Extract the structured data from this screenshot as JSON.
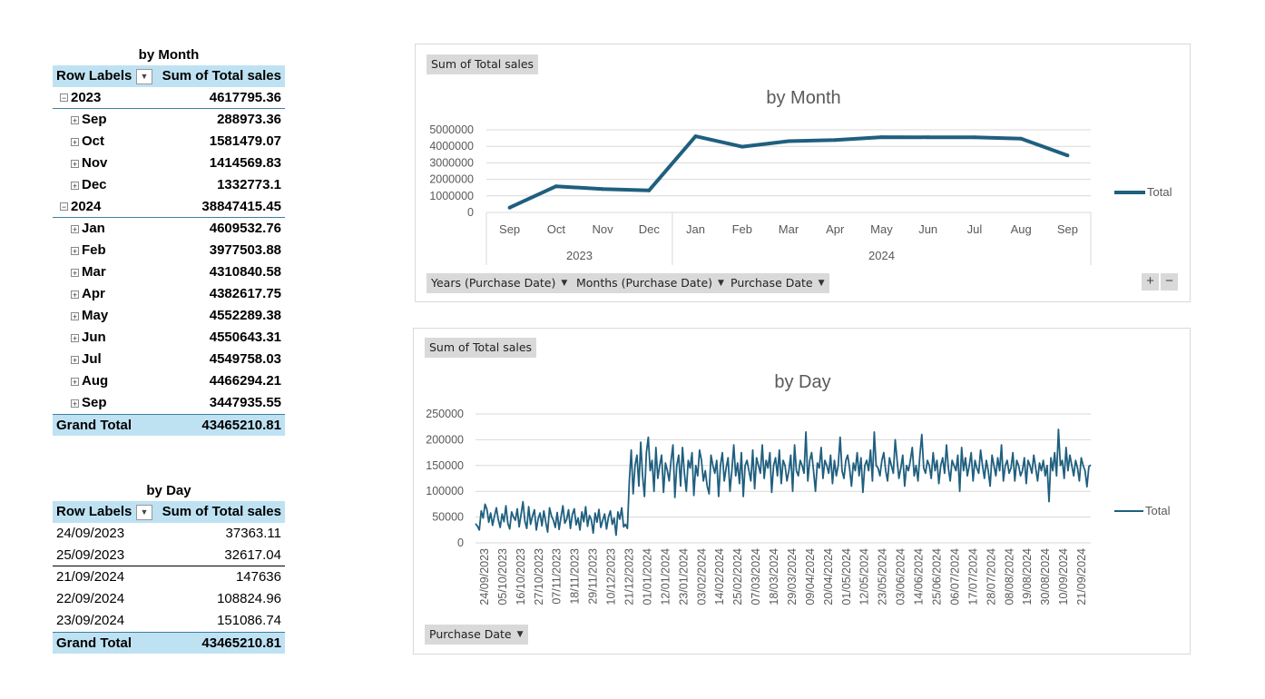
{
  "pivot_month": {
    "title": "by Month",
    "header": {
      "row_labels": "Row Labels",
      "value_col": "Sum of Total sales"
    },
    "years": [
      {
        "label": "2023",
        "value": "4617795.36",
        "toggle": "−",
        "months": [
          {
            "label": "Sep",
            "value": "288973.36"
          },
          {
            "label": "Oct",
            "value": "1581479.07"
          },
          {
            "label": "Nov",
            "value": "1414569.83"
          },
          {
            "label": "Dec",
            "value": "1332773.1"
          }
        ]
      },
      {
        "label": "2024",
        "value": "38847415.45",
        "toggle": "−",
        "months": [
          {
            "label": "Jan",
            "value": "4609532.76"
          },
          {
            "label": "Feb",
            "value": "3977503.88"
          },
          {
            "label": "Mar",
            "value": "4310840.58"
          },
          {
            "label": "Apr",
            "value": "4382617.75"
          },
          {
            "label": "May",
            "value": "4552289.38"
          },
          {
            "label": "Jun",
            "value": "4550643.31"
          },
          {
            "label": "Jul",
            "value": "4549758.03"
          },
          {
            "label": "Aug",
            "value": "4466294.21"
          },
          {
            "label": "Sep",
            "value": "3447935.55"
          }
        ]
      }
    ],
    "grand_total": {
      "label": "Grand Total",
      "value": "43465210.81"
    }
  },
  "pivot_day": {
    "title": "by Day",
    "header": {
      "row_labels": "Row Labels",
      "value_col": "Sum of Total sales"
    },
    "rows": [
      {
        "label": "24/09/2023",
        "value": "37363.11"
      },
      {
        "label": "25/09/2023",
        "value": "32617.04"
      },
      {
        "label": "21/09/2024",
        "value": "147636"
      },
      {
        "label": "22/09/2024",
        "value": "108824.96"
      },
      {
        "label": "23/09/2024",
        "value": "151086.74"
      }
    ],
    "grand_total": {
      "label": "Grand Total",
      "value": "43465210.81"
    }
  },
  "chart_month_ui": {
    "field_button": "Sum of Total sales",
    "axis_buttons": [
      "Years (Purchase Date)",
      "Months (Purchase Date)",
      "Purchase Date"
    ],
    "plus": "+",
    "minus": "−",
    "legend": "Total"
  },
  "chart_day_ui": {
    "field_button": "Sum of Total sales",
    "axis_button": "Purchase Date",
    "legend": "Total"
  },
  "colors": {
    "line": "#1f5f7f",
    "header_fill": "#bfe2f3"
  },
  "chart_data": [
    {
      "type": "line",
      "title": "by Month",
      "categories": [
        "Sep",
        "Oct",
        "Nov",
        "Dec",
        "Jan",
        "Feb",
        "Mar",
        "Apr",
        "May",
        "Jun",
        "Jul",
        "Aug",
        "Sep"
      ],
      "groups": [
        {
          "label": "2023",
          "count": 4
        },
        {
          "label": "2024",
          "count": 9
        }
      ],
      "series": [
        {
          "name": "Total",
          "values": [
            288973.36,
            1581479.07,
            1414569.83,
            1332773.1,
            4609532.76,
            3977503.88,
            4310840.58,
            4382617.75,
            4552289.38,
            4550643.31,
            4549758.03,
            4466294.21,
            3447935.55
          ]
        }
      ],
      "ylim": [
        0,
        5000000
      ],
      "yticks": [
        "5000000",
        "4000000",
        "3000000",
        "2000000",
        "1000000",
        "0"
      ],
      "grid": true,
      "legend_position": "right"
    },
    {
      "type": "line",
      "title": "by Day",
      "x_tick_labels": [
        "24/09/2023",
        "05/10/2023",
        "16/10/2023",
        "27/10/2023",
        "07/11/2023",
        "18/11/2023",
        "29/11/2023",
        "10/12/2023",
        "21/12/2023",
        "01/01/2024",
        "12/01/2024",
        "23/01/2024",
        "03/02/2024",
        "14/02/2024",
        "25/02/2024",
        "07/03/2024",
        "18/03/2024",
        "29/03/2024",
        "09/04/2024",
        "20/04/2024",
        "01/05/2024",
        "12/05/2024",
        "23/05/2024",
        "03/06/2024",
        "14/06/2024",
        "25/06/2024",
        "06/07/2024",
        "17/07/2024",
        "28/07/2024",
        "08/08/2024",
        "19/08/2024",
        "30/08/2024",
        "10/09/2024",
        "21/09/2024"
      ],
      "series": [
        {
          "name": "Total",
          "values": [
            37363,
            32617,
            25000,
            62000,
            48000,
            75000,
            65000,
            40000,
            58000,
            34000,
            52000,
            68000,
            45000,
            30000,
            56000,
            41000,
            72000,
            38000,
            27000,
            60000,
            50000,
            44000,
            66000,
            31000,
            55000,
            80000,
            42000,
            28000,
            70000,
            36000,
            52000,
            64000,
            25000,
            47000,
            58000,
            33000,
            62000,
            40000,
            21000,
            68000,
            52000,
            44000,
            30000,
            59000,
            26000,
            50000,
            72000,
            38000,
            45000,
            64000,
            28000,
            55000,
            66000,
            35000,
            48000,
            25000,
            60000,
            41000,
            70000,
            32000,
            53000,
            45000,
            19000,
            58000,
            40000,
            65000,
            30000,
            44000,
            56000,
            27000,
            50000,
            62000,
            36000,
            48000,
            15000,
            60000,
            46000,
            68000,
            31000,
            36000,
            28000,
            120000,
            180000,
            95000,
            150000,
            170000,
            110000,
            195000,
            130000,
            90000,
            175000,
            205000,
            140000,
            160000,
            100000,
            185000,
            125000,
            150000,
            170000,
            98000,
            155000,
            140000,
            120000,
            160000,
            190000,
            88000,
            150000,
            170000,
            110000,
            185000,
            135000,
            100000,
            160000,
            145000,
            175000,
            92000,
            150000,
            130000,
            180000,
            160000,
            120000,
            140000,
            110000,
            95000,
            170000,
            150000,
            135000,
            160000,
            90000,
            150000,
            175000,
            120000,
            145000,
            165000,
            100000,
            140000,
            190000,
            130000,
            155000,
            115000,
            175000,
            90000,
            150000,
            160000,
            140000,
            120000,
            180000,
            105000,
            165000,
            150000,
            135000,
            190000,
            125000,
            160000,
            145000,
            175000,
            98000,
            150000,
            165000,
            130000,
            180000,
            115000,
            160000,
            150000,
            120000,
            140000,
            170000,
            100000,
            190000,
            140000,
            130000,
            160000,
            150000,
            135000,
            215000,
            120000,
            160000,
            175000,
            140000,
            100000,
            155000,
            145000,
            185000,
            125000,
            160000,
            150000,
            135000,
            170000,
            115000,
            160000,
            130000,
            150000,
            205000,
            140000,
            125000,
            160000,
            170000,
            145000,
            110000,
            155000,
            140000,
            175000,
            130000,
            165000,
            98000,
            150000,
            160000,
            140000,
            180000,
            120000,
            215000,
            150000,
            145000,
            130000,
            160000,
            175000,
            140000,
            120000,
            165000,
            150000,
            135000,
            200000,
            160000,
            125000,
            145000,
            170000,
            110000,
            150000,
            140000,
            160000,
            185000,
            130000,
            150000,
            120000,
            170000,
            210000,
            145000,
            135000,
            160000,
            150000,
            125000,
            175000,
            140000,
            160000,
            115000,
            150000,
            165000,
            135000,
            190000,
            145000,
            120000,
            160000,
            150000,
            140000,
            170000,
            100000,
            185000,
            140000,
            165000,
            130000,
            150000,
            175000,
            120000,
            160000,
            145000,
            135000,
            180000,
            150000,
            125000,
            160000,
            140000,
            110000,
            170000,
            150000,
            130000,
            165000,
            140000,
            190000,
            120000,
            150000,
            160000,
            135000,
            145000,
            175000,
            120000,
            160000,
            150000,
            130000,
            140000,
            165000,
            115000,
            160000,
            150000,
            135000,
            170000,
            145000,
            120000,
            155000,
            140000,
            160000,
            130000,
            150000,
            80000,
            165000,
            140000,
            175000,
            130000,
            220000,
            150000,
            160000,
            125000,
            185000,
            140000,
            170000,
            150000,
            130000,
            160000,
            145000,
            120000,
            165000,
            150000,
            140000,
            108825,
            147636,
            151087
          ]
        }
      ],
      "ylim": [
        0,
        250000
      ],
      "yticks": [
        "250000",
        "200000",
        "150000",
        "100000",
        "50000",
        "0"
      ],
      "grid": true,
      "legend_position": "right"
    }
  ]
}
